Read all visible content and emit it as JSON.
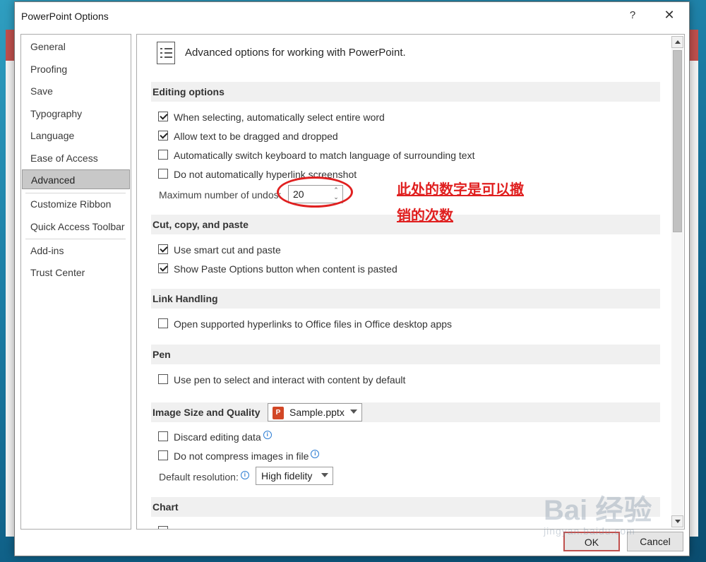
{
  "dialog": {
    "title": "PowerPoint Options",
    "help_label": "?",
    "close_label": "✕"
  },
  "nav": {
    "items": [
      {
        "label": "General"
      },
      {
        "label": "Proofing"
      },
      {
        "label": "Save"
      },
      {
        "label": "Typography"
      },
      {
        "label": "Language"
      },
      {
        "label": "Ease of Access"
      },
      {
        "label": "Advanced",
        "selected": true
      },
      {
        "label": "Customize Ribbon"
      },
      {
        "label": "Quick Access Toolbar"
      },
      {
        "label": "Add-ins"
      },
      {
        "label": "Trust Center"
      }
    ]
  },
  "panel": {
    "heading": "Advanced options for working with PowerPoint.",
    "sections": {
      "editing": "Editing options",
      "cut_copy_paste": "Cut, copy, and paste",
      "link_handling": "Link Handling",
      "pen": "Pen",
      "image_size": "Image Size and Quality",
      "chart": "Chart"
    },
    "editing_options": [
      {
        "label": "When selecting, automatically select entire word",
        "checked": true
      },
      {
        "label": "Allow text to be dragged and dropped",
        "checked": true
      },
      {
        "label": "Automatically switch keyboard to match language of surrounding text",
        "checked": false
      },
      {
        "label": "Do not automatically hyperlink screenshot",
        "checked": false
      }
    ],
    "max_undos": {
      "label": "Maximum number of undos:",
      "value": "20"
    },
    "cut_copy_paste_options": [
      {
        "label": "Use smart cut and paste",
        "checked": true
      },
      {
        "label": "Show Paste Options button when content is pasted",
        "checked": true
      }
    ],
    "link_options": [
      {
        "label": "Open supported hyperlinks to Office files in Office desktop apps",
        "checked": false
      }
    ],
    "pen_options": [
      {
        "label": "Use pen to select and interact with content by default",
        "checked": false
      }
    ],
    "image_file": "Sample.pptx",
    "image_options": [
      {
        "label": "Discard editing data",
        "checked": false
      },
      {
        "label": "Do not compress images in file",
        "checked": false
      }
    ],
    "default_resolution": {
      "label": "Default resolution:",
      "value": "High fidelity"
    },
    "info_glyph": "i",
    "ppt_glyph": "P"
  },
  "annotation": {
    "line1": "此处的数字是可以撤",
    "line2": "销的次数",
    "color": "#e02020"
  },
  "footer": {
    "ok_label": "OK",
    "cancel_label": "Cancel"
  },
  "watermark": {
    "main": "Bai 经验",
    "sub": "jingyan.baidu.com"
  },
  "colors": {
    "selected_nav": "#c8c8c8",
    "section_bg": "#f0f0f0",
    "ok_border": "#c0504d"
  }
}
